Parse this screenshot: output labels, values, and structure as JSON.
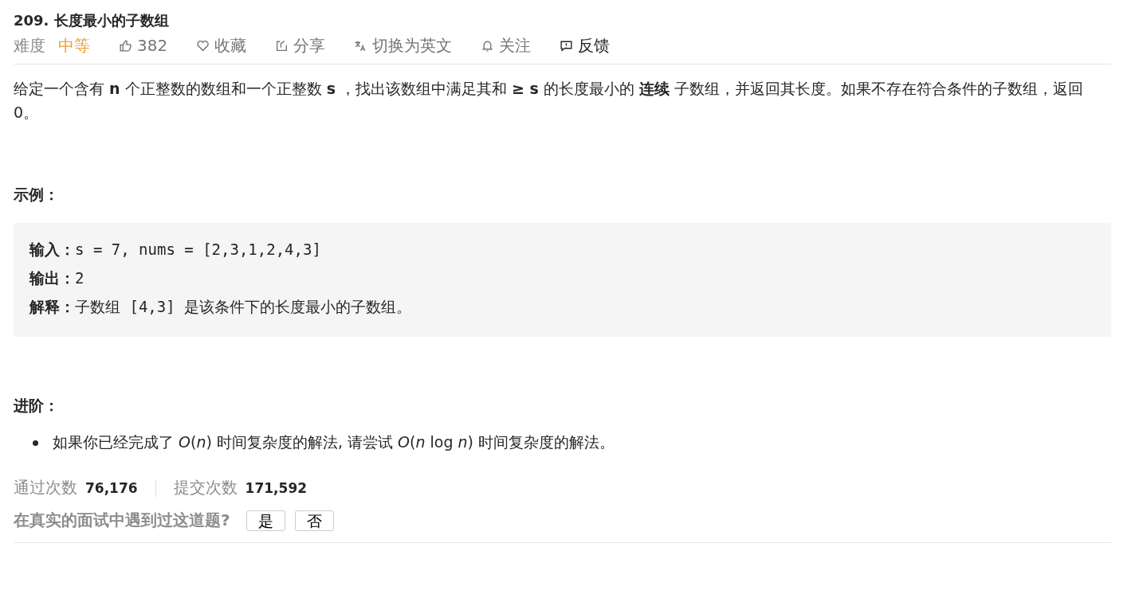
{
  "title": "209. 长度最小的子数组",
  "meta": {
    "difficulty_label": "难度",
    "difficulty": "中等",
    "actions": [
      {
        "kind": "like",
        "label": "382",
        "active": false
      },
      {
        "kind": "favorite",
        "label": "收藏",
        "active": false
      },
      {
        "kind": "share",
        "label": "分享",
        "active": false
      },
      {
        "kind": "translate",
        "label": "切换为英文",
        "active": false
      },
      {
        "kind": "follow",
        "label": "关注",
        "active": false
      },
      {
        "kind": "feedback",
        "label": "反馈",
        "active": true
      }
    ]
  },
  "description": "给定一个含有 **n** 个正整数的数组和一个正整数 **s** ，找出该数组中满足其和 **≥ s** 的长度最小的 **连续** 子数组，并返回其长度。如果不存在符合条件的子数组，返回 0。",
  "example": {
    "heading": "示例：",
    "lines": [
      "**输入：**s = 7, nums = [2,3,1,2,4,3]",
      "**输出：**2",
      "**解释：**子数组 [4,3] 是该条件下的长度最小的子数组。"
    ]
  },
  "advanced": {
    "heading": "进阶：",
    "items": [
      "如果你已经完成了 *O*(*n*) 时间复杂度的解法, 请尝试 *O*(*n* log *n*) 时间复杂度的解法。"
    ]
  },
  "stats": [
    {
      "label": "通过次数",
      "value": "76,176"
    },
    {
      "label": "提交次数",
      "value": "171,592"
    }
  ],
  "interview": {
    "question": "在真实的面试中遇到过这道题?",
    "buttons": [
      "是",
      "否"
    ]
  }
}
